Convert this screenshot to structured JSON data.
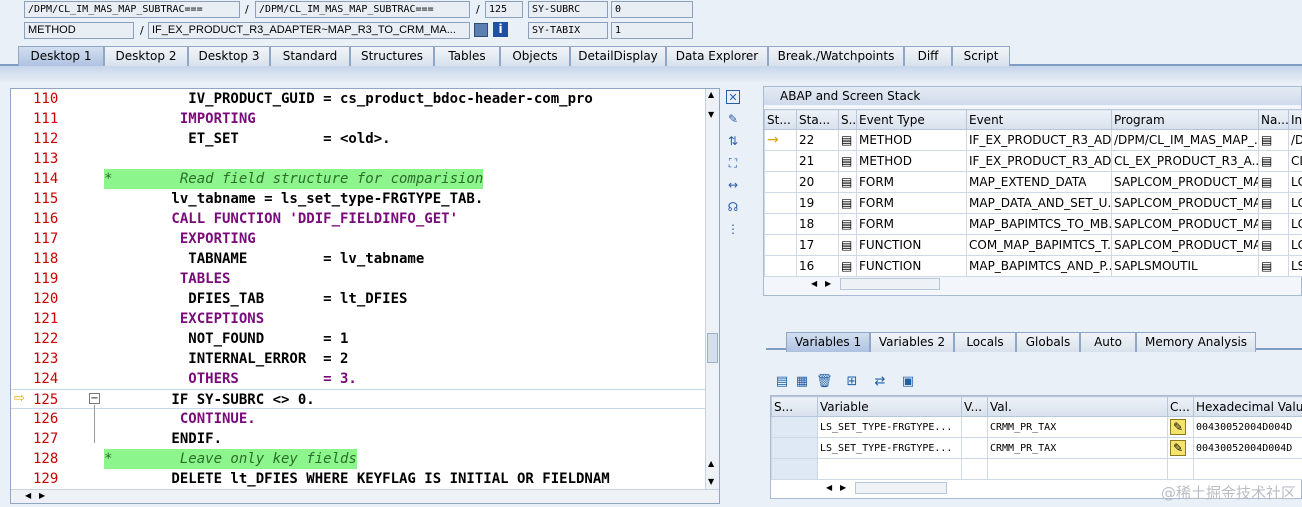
{
  "header": {
    "row1": {
      "field1": "/DPM/CL_IM_MAS_MAP_SUBTRAC===",
      "sep1": "/",
      "field2": "/DPM/CL_IM_MAS_MAP_SUBTRAC===",
      "sep2": "/",
      "field3": "125",
      "field4": "SY-SUBRC",
      "field5": "0"
    },
    "row2": {
      "field1": "METHOD",
      "sep1": "/",
      "field2": "IF_EX_PRODUCT_R3_ADAPTER~MAP_R3_TO_CRM_MA...",
      "field4": "SY-TABIX",
      "field5": "1"
    }
  },
  "tabs": [
    "Desktop 1",
    "Desktop 2",
    "Desktop 3",
    "Standard",
    "Structures",
    "Tables",
    "Objects",
    "DetailDisplay",
    "Data Explorer",
    "Break./Watchpoints",
    "Diff",
    "Script"
  ],
  "code": {
    "lines": [
      {
        "n": "110",
        "t": "          IV_PRODUCT_GUID = cs_product_bdoc-header-com_pro"
      },
      {
        "n": "111",
        "t": "         IMPORTING"
      },
      {
        "n": "112",
        "t": "          ET_SET          = <old>."
      },
      {
        "n": "113",
        "t": ""
      },
      {
        "n": "114",
        "t": "*        Read field structure for comparision"
      },
      {
        "n": "115",
        "t": "        lv_tabname = ls_set_type-FRGTYPE_TAB."
      },
      {
        "n": "116",
        "t": "        CALL FUNCTION 'DDIF_FIELDINFO_GET'"
      },
      {
        "n": "117",
        "t": "         EXPORTING"
      },
      {
        "n": "118",
        "t": "          TABNAME         = lv_tabname"
      },
      {
        "n": "119",
        "t": "         TABLES"
      },
      {
        "n": "120",
        "t": "          DFIES_TAB       = lt_DFIES"
      },
      {
        "n": "121",
        "t": "         EXCEPTIONS"
      },
      {
        "n": "122",
        "t": "          NOT_FOUND       = 1"
      },
      {
        "n": "123",
        "t": "          INTERNAL_ERROR  = 2"
      },
      {
        "n": "124",
        "t": "          OTHERS          = 3."
      },
      {
        "n": "125",
        "t": "        IF SY-SUBRC <> 0."
      },
      {
        "n": "126",
        "t": "         CONTINUE."
      },
      {
        "n": "127",
        "t": "        ENDIF."
      },
      {
        "n": "128",
        "t": "*        Leave only key fields"
      },
      {
        "n": "129",
        "t": "        DELETE lt_DFIES WHERE KEYFLAG IS INITIAL OR FIELDNAM"
      }
    ]
  },
  "stack": {
    "title": "ABAP and Screen Stack",
    "columns": [
      "St...",
      "Sta...",
      "S...",
      "Event Type",
      "Event",
      "Program",
      "Na...",
      "In"
    ],
    "rows": [
      {
        "st": "→",
        "num": "22",
        "type": "METHOD",
        "event": "IF_EX_PRODUCT_R3_AD...",
        "program": "/DPM/CL_IM_MAS_MAP_...",
        "in": "/D"
      },
      {
        "st": "",
        "num": "21",
        "type": "METHOD",
        "event": "IF_EX_PRODUCT_R3_AD...",
        "program": "CL_EX_PRODUCT_R3_A...",
        "in": "CL"
      },
      {
        "st": "",
        "num": "20",
        "type": "FORM",
        "event": "MAP_EXTEND_DATA",
        "program": "SAPLCOM_PRODUCT_MA...",
        "in": "LC"
      },
      {
        "st": "",
        "num": "19",
        "type": "FORM",
        "event": "MAP_DATA_AND_SET_U...",
        "program": "SAPLCOM_PRODUCT_MA...",
        "in": "LC"
      },
      {
        "st": "",
        "num": "18",
        "type": "FORM",
        "event": "MAP_BAPIMTCS_TO_MB...",
        "program": "SAPLCOM_PRODUCT_MA...",
        "in": "LC"
      },
      {
        "st": "",
        "num": "17",
        "type": "FUNCTION",
        "event": "COM_MAP_BAPIMTCS_T...",
        "program": "SAPLCOM_PRODUCT_MA...",
        "in": "LC"
      },
      {
        "st": "",
        "num": "16",
        "type": "FUNCTION",
        "event": "MAP_BAPIMTCS_AND_P...",
        "program": "SAPLSMOUTIL",
        "in": "LS"
      }
    ]
  },
  "var_tabs": [
    "Variables 1",
    "Variables 2",
    "Locals",
    "Globals",
    "Auto",
    "Memory Analysis"
  ],
  "variables": {
    "columns": [
      "S...",
      "Variable",
      "V...",
      "Val.",
      "C...",
      "Hexadecimal Value"
    ],
    "rows": [
      {
        "variable": "LS_SET_TYPE-FRGTYPE...",
        "val": "CRMM_PR_TAX",
        "hex": "00430052004D004D"
      },
      {
        "variable": "LS_SET_TYPE-FRGTYPE...",
        "val": "CRMM_PR_TAX",
        "hex": "00430052004D004D"
      },
      {
        "variable": "",
        "val": "",
        "hex": ""
      }
    ]
  },
  "watermark": "@稀土掘金技术社区"
}
